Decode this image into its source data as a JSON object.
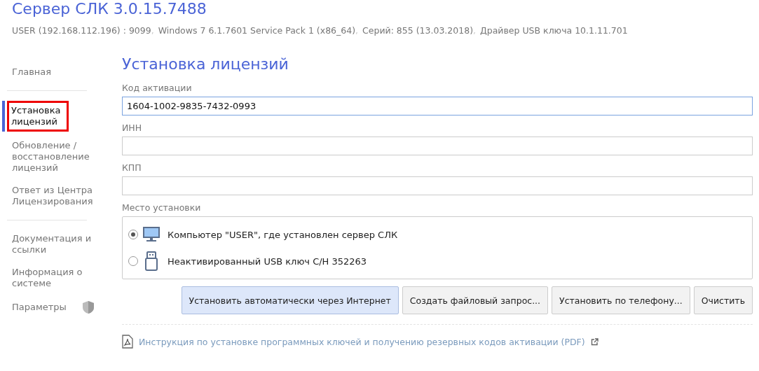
{
  "header": {
    "title": "Сервер СЛК 3.0.15.7488",
    "separator": ",",
    "info": [
      "USER (192.168.112.196) : 9099",
      "Windows 7 6.1.7601 Service Pack 1 (x86_64)",
      "Серий: 855 (13.03.2018)",
      "Драйвер USB ключа 10.1.11.701"
    ]
  },
  "sidebar": {
    "groups": [
      [
        {
          "label": "Главная",
          "selected": false,
          "annotated": false
        }
      ],
      [
        {
          "label": "Установка лицензий",
          "selected": true,
          "annotated": true
        },
        {
          "label": "Обновление / восстановление лицензий",
          "selected": false,
          "annotated": false
        },
        {
          "label": "Ответ из Центра Лицензирования",
          "selected": false,
          "annotated": false
        }
      ],
      [
        {
          "label": "Документация и ссылки",
          "selected": false,
          "annotated": false
        },
        {
          "label": "Информация о системе",
          "selected": false,
          "annotated": false
        },
        {
          "label": "Параметры",
          "selected": false,
          "annotated": false,
          "kind": "shield"
        }
      ]
    ]
  },
  "page": {
    "heading": "Установка лицензий",
    "fields": [
      {
        "label": "Код активации",
        "value": "1604-1002-9835-7432-0993",
        "focused": true
      },
      {
        "label": "ИНН",
        "focused": false
      },
      {
        "label": "КПП",
        "focused": false
      }
    ],
    "location": {
      "label": "Место установки",
      "options": [
        {
          "label": "Компьютер \"USER\", где установлен сервер СЛК",
          "selected": true,
          "kind": "monitor"
        },
        {
          "label": "Неактивированный USB ключ С/Н 352263",
          "selected": false,
          "kind": "usb"
        }
      ]
    },
    "buttons": [
      {
        "label": "Установить автоматически через Интернет",
        "primary": true
      },
      {
        "label": "Создать файловый запрос...",
        "primary": false
      },
      {
        "label": "Установить по телефону...",
        "primary": false
      },
      {
        "label": "Очистить",
        "primary": false
      }
    ],
    "doc_link": "Инструкция по установке программных ключей и получению резервных кодов активации (PDF)"
  }
}
